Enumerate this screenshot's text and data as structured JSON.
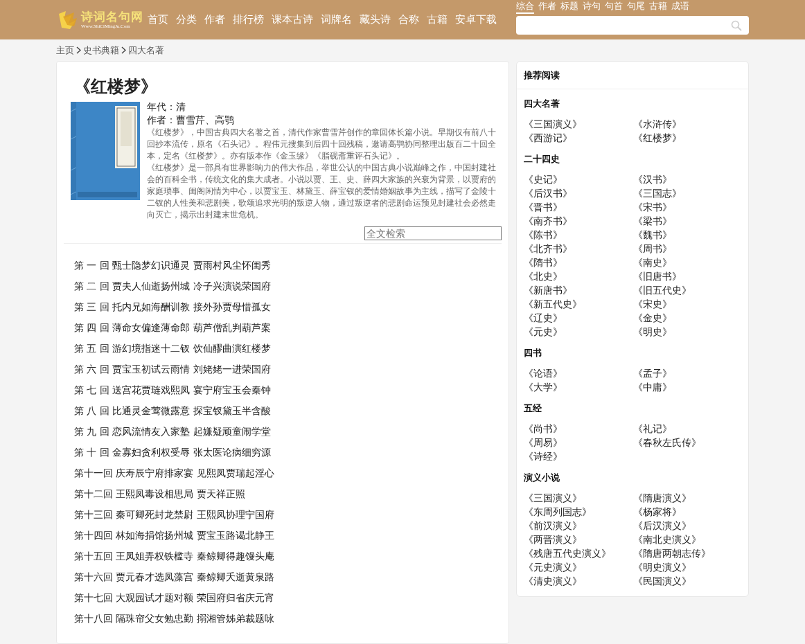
{
  "header": {
    "logo": {
      "name": "诗词名句网",
      "url": "Www.ShiCiMingJu.Com"
    },
    "nav": [
      "首页",
      "分类",
      "作者",
      "排行榜",
      "课本古诗",
      "词牌名",
      "藏头诗",
      "合称",
      "古籍",
      "安卓下载"
    ],
    "search_tabs": [
      {
        "label": "综合",
        "selected": true
      },
      {
        "label": "作者",
        "selected": false
      },
      {
        "label": "标题",
        "selected": false
      },
      {
        "label": "诗句",
        "selected": false
      },
      {
        "label": "句首",
        "selected": false
      },
      {
        "label": "句尾",
        "selected": false
      },
      {
        "label": "古籍",
        "selected": false
      },
      {
        "label": "成语",
        "selected": false
      }
    ]
  },
  "breadcrumb": [
    "主页",
    "史书典籍",
    "四大名著"
  ],
  "book": {
    "title": "《红楼梦》",
    "cover": {
      "kind": "picture"
    },
    "era": "年代：清",
    "author": "作者：曹雪芹、高鹗",
    "description": [
      "《红楼梦》，中国古典四大名著之首，清代作家曹雪芹创作的章回体长篇小说。早期仅有前八十回抄本流传，原名《石头记》。程伟元搜集到后四十回残稿，邀请高鹗协同整理出版百二十回全本，定名《红楼梦》。亦有版本作《金玉缘》《脂砚斋重评石头记》。",
      "《红楼梦》是一部具有世界影响力的伟大作品，举世公认的中国古典小说巅峰之作，中国封建社会的百科全书，传统文化的集大成者。小说以贾、王、史、薛四大家族的兴衰为背景，以贾府的家庭琐事、闺阁闲情为中心，以贾宝玉、林黛玉、薛宝钗的爱情婚姻故事为主线，描写了金陵十二钗的人性美和悲剧美，歌颂追求光明的叛逆人物，通过叛逆者的悲剧命运预见封建社会必然走向灭亡，揭示出封建末世危机。"
    ],
    "search": {
      "placeholder": "全文检索"
    }
  },
  "chapters": [
    {
      "number": "第 一 回",
      "title": "甄士隐梦幻识通灵 贾雨村风尘怀闺秀"
    },
    {
      "number": "第 二 回",
      "title": "贾夫人仙逝扬州城 冷子兴演说荣国府"
    },
    {
      "number": "第 三 回",
      "title": "托内兄如海酬训教 接外孙贾母惜孤女"
    },
    {
      "number": "第 四 回",
      "title": "薄命女偏逢薄命郎 葫芦僧乱判葫芦案"
    },
    {
      "number": "第 五 回",
      "title": "游幻境指迷十二钗 饮仙醪曲演红楼梦"
    },
    {
      "number": "第 六 回",
      "title": "贾宝玉初试云雨情 刘姥姥一进荣国府"
    },
    {
      "number": "第 七 回",
      "title": "送宫花贾琏戏熙凤 宴宁府宝玉会秦钟"
    },
    {
      "number": "第 八 回",
      "title": "比通灵金莺微露意 探宝钗黛玉半含酸"
    },
    {
      "number": "第 九 回",
      "title": "恋风流情友入家塾 起嫌疑顽童闹学堂"
    },
    {
      "number": "第 十 回",
      "title": "金寡妇贪利权受辱 张太医论病细穷源"
    },
    {
      "number": "第十一回",
      "title": "庆寿辰宁府排家宴 见熙凤贾瑞起淫心"
    },
    {
      "number": "第十二回",
      "title": "王熙凤毒设相思局 贾天祥正照"
    },
    {
      "number": "第十三回",
      "title": "秦可卿死封龙禁尉 王熙凤协理宁国府"
    },
    {
      "number": "第十四回",
      "title": "林如海捐馆扬州城 贾宝玉路谒北静王"
    },
    {
      "number": "第十五回",
      "title": "王凤姐弄权铁槛寺 秦鲸卿得趣馒头庵"
    },
    {
      "number": "第十六回",
      "title": "贾元春才选凤藻宫 秦鲸卿夭逝黄泉路"
    },
    {
      "number": "第十七回",
      "title": "大观园试才题对额 荣国府归省庆元宵"
    },
    {
      "number": "第十八回",
      "title": "隔珠帘父女勉忠勤 搦湘管姊弟裁题咏"
    }
  ],
  "sidebar": {
    "title": "推荐阅读",
    "sections": [
      {
        "heading": "四大名著",
        "items": [
          "《三国演义》",
          "《水浒传》",
          "《西游记》",
          "《红楼梦》"
        ]
      },
      {
        "heading": "二十四史",
        "items": [
          "《史记》",
          "《汉书》",
          "《后汉书》",
          "《三国志》",
          "《晋书》",
          "《宋书》",
          "《南齐书》",
          "《梁书》",
          "《陈书》",
          "《魏书》",
          "《北齐书》",
          "《周书》",
          "《隋书》",
          "《南史》",
          "《北史》",
          "《旧唐书》",
          "《新唐书》",
          "《旧五代史》",
          "《新五代史》",
          "《宋史》",
          "《辽史》",
          "《金史》",
          "《元史》",
          "《明史》"
        ]
      },
      {
        "heading": "四书",
        "items": [
          "《论语》",
          "《孟子》",
          "《大学》",
          "《中庸》"
        ]
      },
      {
        "heading": "五经",
        "items": [
          "《尚书》",
          "《礼记》",
          "《周易》",
          "《春秋左氏传》",
          "《诗经》"
        ]
      },
      {
        "heading": "演义小说",
        "items": [
          "《三国演义》",
          "《隋唐演义》",
          "《东周列国志》",
          "《杨家将》",
          "《前汉演义》",
          "《后汉演义》",
          "《两晋演义》",
          "《南北史演义》",
          "《残唐五代史演义》",
          "《隋唐两朝志传》",
          "《元史演义》",
          "《明史演义》",
          "《清史演义》",
          "《民国演义》"
        ]
      }
    ]
  }
}
